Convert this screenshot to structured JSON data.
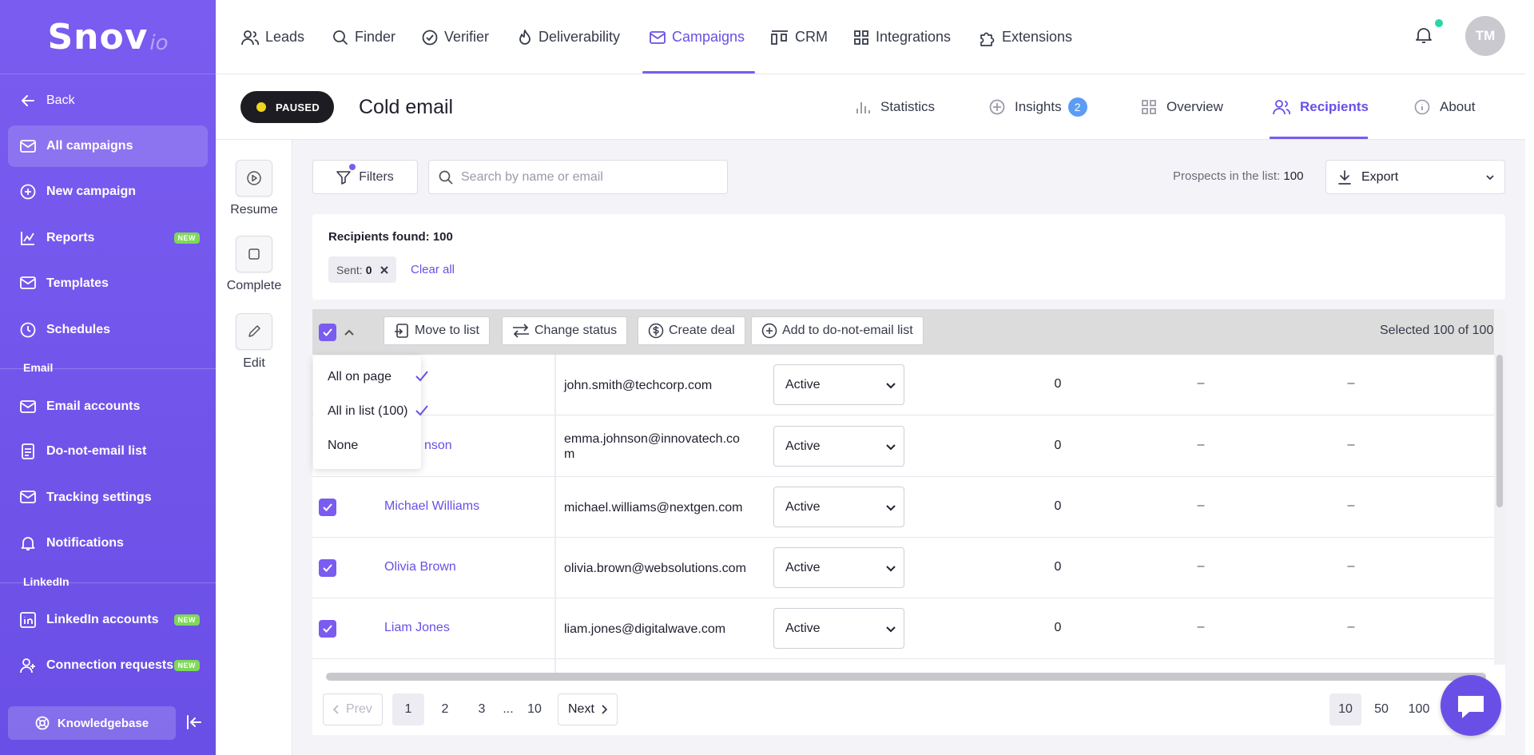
{
  "brand": {
    "logo_main": "Snov",
    "logo_sub": "io"
  },
  "sidebar": {
    "back": "Back",
    "items": [
      {
        "label": "All campaigns",
        "icon": "envelope-icon",
        "active": true
      },
      {
        "label": "New campaign",
        "icon": "plus-circle-icon"
      },
      {
        "label": "Reports",
        "icon": "chart-icon",
        "badge": "NEW"
      },
      {
        "label": "Templates",
        "icon": "template-icon"
      },
      {
        "label": "Schedules",
        "icon": "clock-icon"
      }
    ],
    "email_section": "Email",
    "email_items": [
      {
        "label": "Email accounts",
        "icon": "envelope-icon"
      },
      {
        "label": "Do-not-email list",
        "icon": "document-icon"
      },
      {
        "label": "Tracking settings",
        "icon": "tracking-icon"
      },
      {
        "label": "Notifications",
        "icon": "bell-icon"
      }
    ],
    "linkedin_section": "LinkedIn",
    "linkedin_items": [
      {
        "label": "LinkedIn accounts",
        "icon": "linkedin-icon",
        "badge": "NEW"
      },
      {
        "label": "Connection requests",
        "icon": "user-plus-icon",
        "badge": "NEW"
      }
    ],
    "knowledgebase": "Knowledgebase"
  },
  "topnav": {
    "items": [
      "Leads",
      "Finder",
      "Verifier",
      "Deliverability",
      "Campaigns",
      "CRM",
      "Integrations",
      "Extensions"
    ],
    "active": "Campaigns",
    "avatar": "TM"
  },
  "campaign": {
    "status": "PAUSED",
    "title": "Cold email",
    "tabs": {
      "statistics": "Statistics",
      "insights": "Insights",
      "insights_count": "2",
      "overview": "Overview",
      "recipients": "Recipients",
      "about": "About"
    }
  },
  "actions": {
    "resume": "Resume",
    "complete": "Complete",
    "edit": "Edit"
  },
  "toolbar": {
    "filters": "Filters",
    "search_placeholder": "Search by name or email",
    "prospects_label": "Prospects in the list:",
    "prospects_count": "100",
    "export": "Export"
  },
  "results": {
    "found_label": "Recipients found: 100",
    "chip_label": "Sent:",
    "chip_value": "0",
    "clear_all": "Clear all"
  },
  "bulk": {
    "move": "Move to list",
    "change_status": "Change status",
    "create_deal": "Create deal",
    "add_dne": "Add to do-not-email list",
    "selected": "Selected 100 of 100"
  },
  "select_menu": {
    "all_on_page": "All on page",
    "all_in_list": "All in list (100)",
    "none": "None"
  },
  "rows": [
    {
      "name": "",
      "email": "john.smith@techcorp.com",
      "status": "Active",
      "sent": "0",
      "c2": "–",
      "c3": "–"
    },
    {
      "name": "nson",
      "email": "emma.johnson@innovatech.co\nm",
      "status": "Active",
      "sent": "0",
      "c2": "–",
      "c3": "–"
    },
    {
      "name": "Michael Williams",
      "email": "michael.williams@nextgen.com",
      "status": "Active",
      "sent": "0",
      "c2": "–",
      "c3": "–"
    },
    {
      "name": "Olivia Brown",
      "email": "olivia.brown@websolutions.com",
      "status": "Active",
      "sent": "0",
      "c2": "–",
      "c3": "–"
    },
    {
      "name": "Liam Jones",
      "email": "liam.jones@digitalwave.com",
      "status": "Active",
      "sent": "0",
      "c2": "–",
      "c3": "–"
    }
  ],
  "pagination": {
    "prev": "Prev",
    "pages": [
      "1",
      "2",
      "3",
      "...",
      "10"
    ],
    "current": "1",
    "next": "Next",
    "page_sizes": [
      "10",
      "50",
      "100"
    ],
    "page_size_current": "10"
  },
  "colors": {
    "accent": "#7a5cf0",
    "sidebar": "#6a4fe6",
    "paused_dot": "#f0d51c",
    "online_dot": "#28d6a6",
    "new_badge": "#7ed957"
  }
}
